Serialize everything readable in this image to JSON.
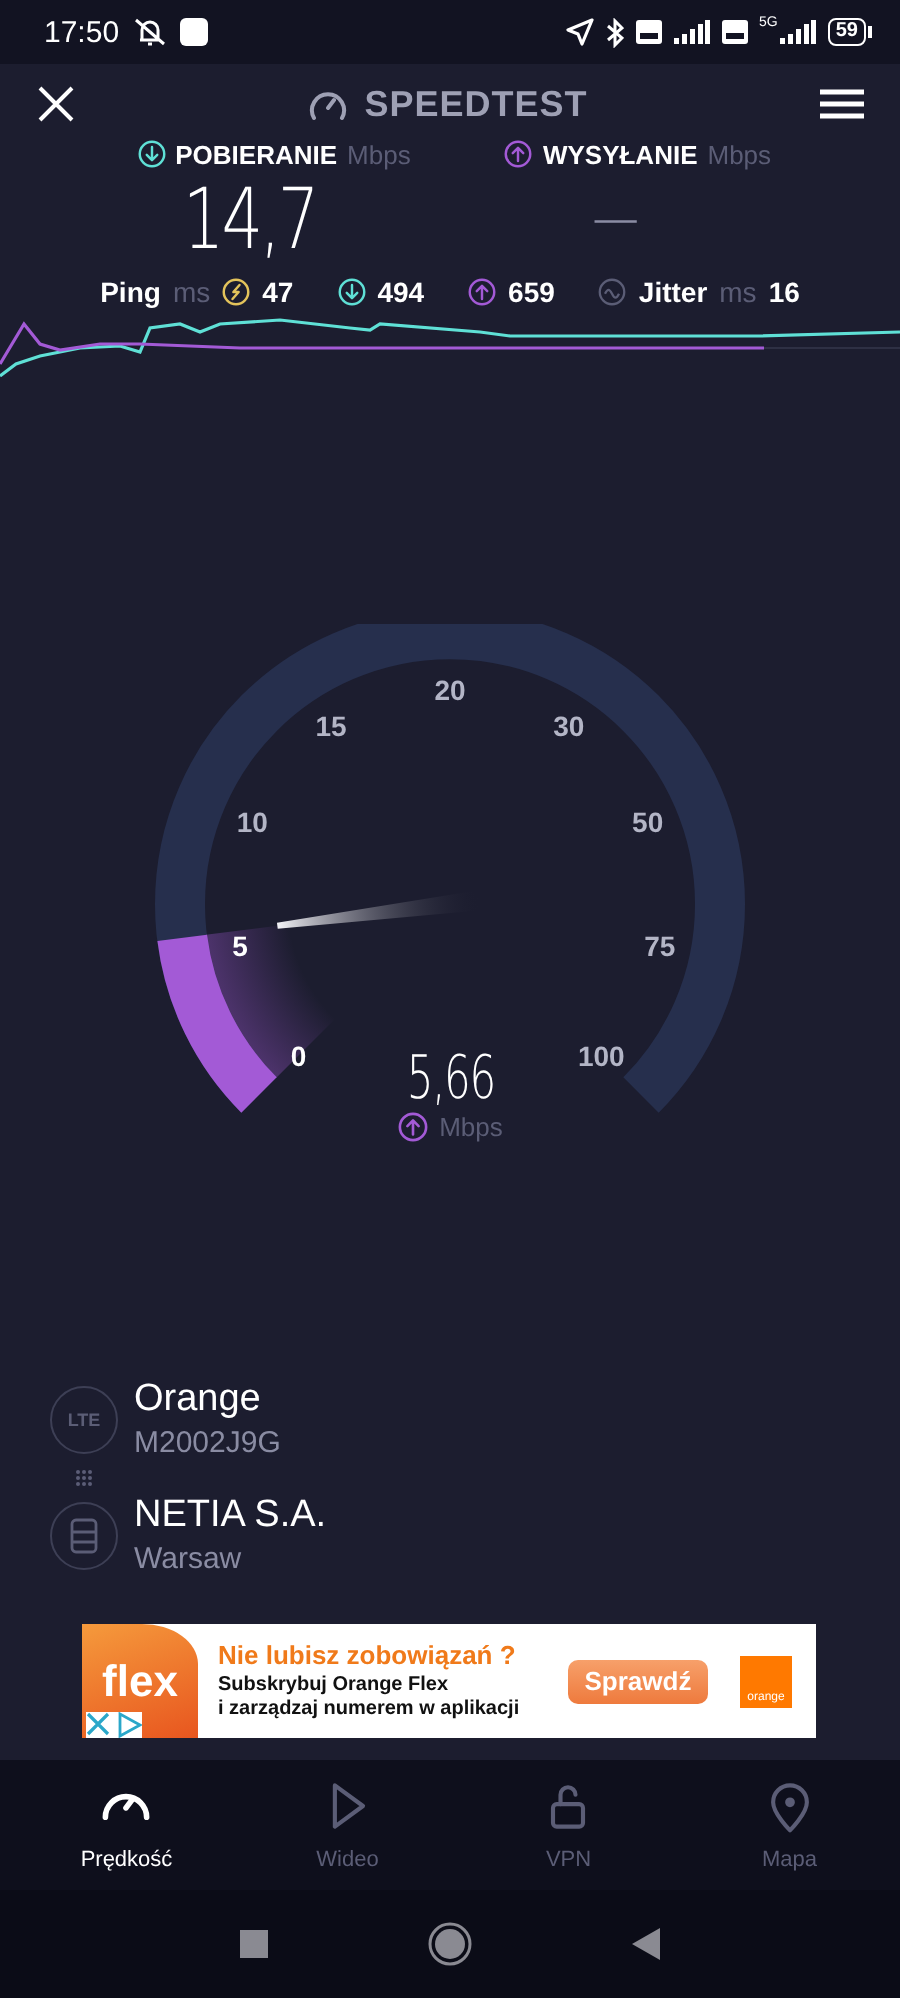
{
  "status_bar": {
    "time": "17:50",
    "battery": "59",
    "network": "5G"
  },
  "header": {
    "title": "SPEEDTEST"
  },
  "results": [
    {
      "kind": "download",
      "label": "POBIERANIE",
      "unit": "Mbps",
      "value": "14,7"
    },
    {
      "kind": "upload",
      "label": "WYSYŁANIE",
      "unit": "Mbps",
      "value": "—"
    }
  ],
  "latency": {
    "label": "Ping",
    "unit": "ms",
    "items": [
      {
        "kind": "idle",
        "value": "47"
      },
      {
        "kind": "download",
        "value": "494"
      },
      {
        "kind": "upload",
        "value": "659"
      }
    ]
  },
  "jitter": {
    "label": "Jitter",
    "unit": "ms",
    "value": "16"
  },
  "gauge": {
    "ticks": [
      "0",
      "5",
      "10",
      "15",
      "20",
      "30",
      "50",
      "75",
      "100"
    ],
    "reading": "5,66",
    "unit": "Mbps"
  },
  "connections": [
    {
      "kind": "lte",
      "badge": "LTE",
      "name": "Orange",
      "detail": "M2002J9G"
    },
    {
      "kind": "server",
      "name": "NETIA S.A.",
      "detail": "Warsaw"
    }
  ],
  "ad": {
    "logo": "flex",
    "headline": "Nie lubisz zobowiązań ?",
    "lines": [
      "Subskrybuj Orange Flex",
      "i zarządzaj numerem w aplikacji"
    ],
    "button": "Sprawdź",
    "brand": "orange"
  },
  "nav": [
    {
      "kind": "speed",
      "label": "Prędkość",
      "selected": true
    },
    {
      "kind": "video",
      "label": "Wideo",
      "selected": false
    },
    {
      "kind": "vpn",
      "label": "VPN",
      "selected": false
    },
    {
      "kind": "map",
      "label": "Mapa",
      "selected": false
    }
  ]
}
